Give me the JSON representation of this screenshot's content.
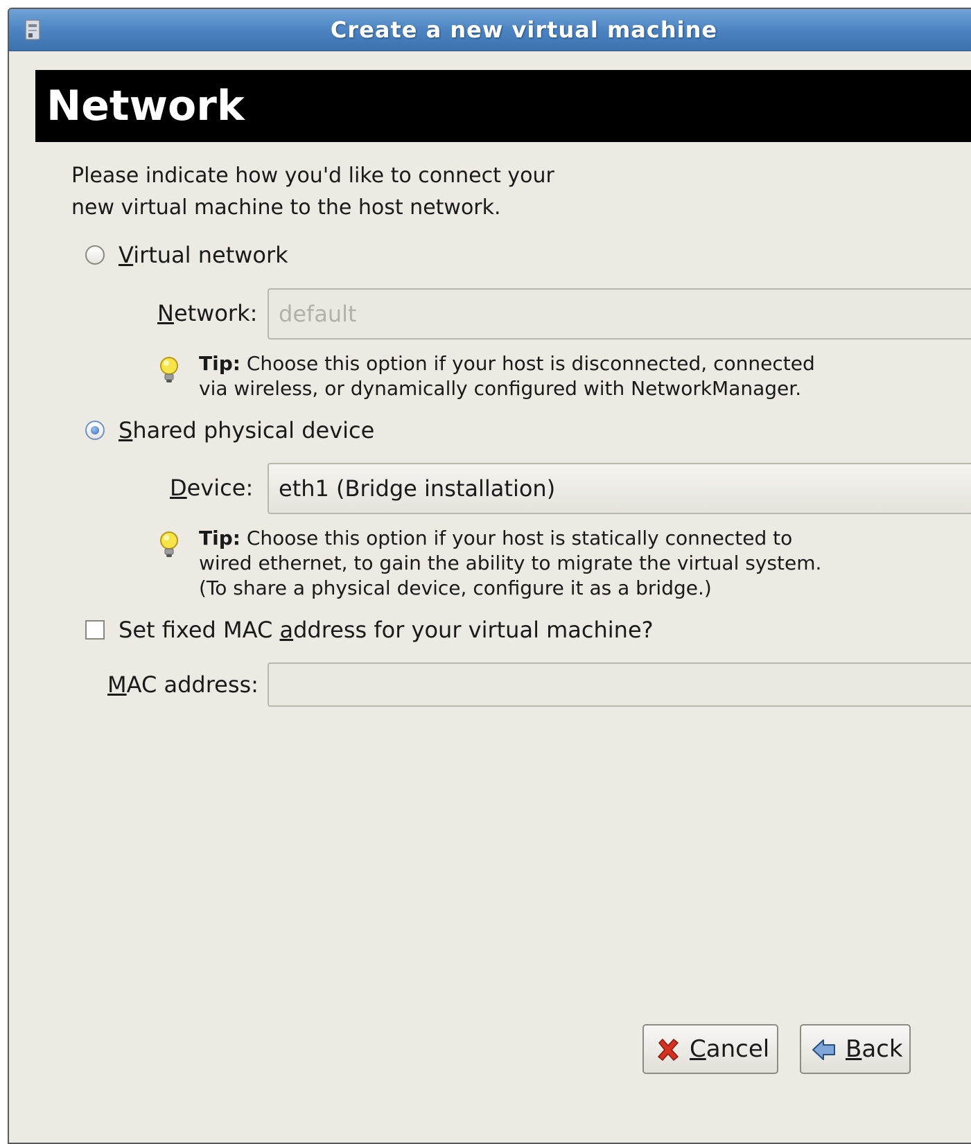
{
  "window": {
    "title": "Create a new virtual machine",
    "app_icon": "vm-manager-icon"
  },
  "header": {
    "title": "Network"
  },
  "intro": {
    "line1": "Please indicate how you'd like to connect your",
    "line2": "new virtual machine to the host network."
  },
  "virtual_network": {
    "label": "Virtual network",
    "checked": false,
    "network_label": "Network:",
    "network_value": "default",
    "tip_bold": "Tip:",
    "tip_line1": " Choose this option if your host is disconnected, connected",
    "tip_line2": "via wireless, or dynamically configured with NetworkManager."
  },
  "shared_device": {
    "label": "Shared physical device",
    "checked": true,
    "device_label": "Device:",
    "device_value": "eth1 (Bridge installation)",
    "tip_bold": "Tip:",
    "tip_line1": " Choose this option if your host is statically connected to",
    "tip_line2": "wired ethernet, to gain the ability to migrate the virtual system.",
    "tip_line3": "(To share a physical device, configure it as a bridge.)"
  },
  "mac": {
    "checkbox_label": "Set fixed MAC address for your virtual machine?",
    "checked": false,
    "field_label": "MAC address:",
    "value": ""
  },
  "buttons": {
    "cancel": "Cancel",
    "back": "Back"
  },
  "colors": {
    "titlebar": "#4a82bf",
    "window_bg": "#edeae4",
    "header_bg": "#000000",
    "radio_selected": "#2f6cbf"
  }
}
